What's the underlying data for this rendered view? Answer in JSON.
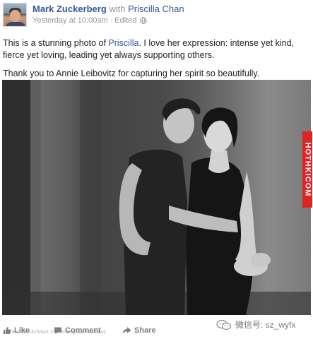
{
  "post": {
    "author": "Mark Zuckerberg",
    "with_text": "with",
    "tagged": "Priscilla Chan",
    "timestamp": "Yesterday at 10:00am",
    "separator": "·",
    "edited": "Edited",
    "text_p1_before": "This is a stunning photo of ",
    "text_p1_link": "Priscilla",
    "text_p1_after": ". I love her expression: intense yet kind, fierce yet loving, leading yet always supporting others.",
    "text_p2": "Thank you to Annie Leibovitz for capturing her spirit so beautifully.",
    "watermark": "HOTHKICOM",
    "caption": "Annie Leibovitz/Mark Zuckerberg via Facebook"
  },
  "actions": {
    "like": "Like",
    "comment": "Comment",
    "share": "Share"
  },
  "wechat": {
    "label": "微信号: sz_wyfx"
  },
  "icons": {
    "privacy": "globe-icon",
    "like": "thumbs-up-icon",
    "comment": "comment-icon",
    "share": "share-icon",
    "wechat": "wechat-icon"
  },
  "colors": {
    "link": "#365899",
    "muted": "#90949c",
    "watermark_bg": "#e02424"
  }
}
